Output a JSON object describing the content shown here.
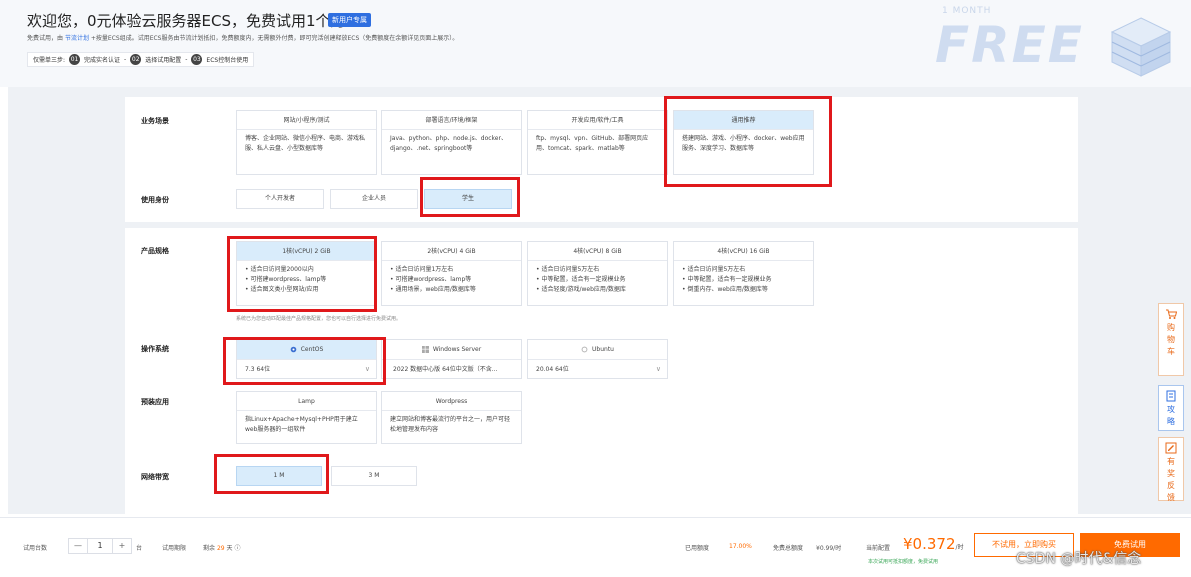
{
  "header": {
    "title": "欢迎您，0元体验云服务器ECS，免费试用1个月",
    "new_badge": "新用户专属",
    "desc_prefix": "免费试用，由",
    "desc_link": "节流计划",
    "desc_rest": "+按量ECS组成。试用ECS服务由节流计划抵扣，免费额度内，无需额外付费，即可完活创建释放ECS（免费额度在余额详见页面上展示）。",
    "steps_intro": "仅需单三步:",
    "steps": [
      {
        "num": "01",
        "label": "完成实名认证"
      },
      {
        "num": "02",
        "label": "选择试用配置"
      },
      {
        "num": "03",
        "label": "ECS控制台使用"
      }
    ],
    "banner_small": "1 MONTH",
    "banner_big": "FREE"
  },
  "scenario": {
    "label": "业务场景",
    "cards": [
      {
        "title": "网站/小程序/测试",
        "body": "博客、企业网站、微信小程序、电商、游戏私服、私人云盘、小型数据库等"
      },
      {
        "title": "部署语言/环境/框架",
        "body": "Java、python、php、node.js、docker、django、.net、springboot等"
      },
      {
        "title": "开发应用/软件/工具",
        "body": "ftp、mysql、vpn、GitHub、部署网页应用、tomcat、spark、matlab等"
      },
      {
        "title": "通用推荐",
        "body": "搭建网站、游戏、小程序、docker、web应用服务、深度学习、数据库等"
      }
    ]
  },
  "identity": {
    "label": "使用身份",
    "options": [
      "个人开发者",
      "企业人员",
      "学生"
    ]
  },
  "spec": {
    "label": "产品规格",
    "cards": [
      {
        "title": "1核(vCPU) 2 GiB",
        "items": [
          "适合日访问量2000以内",
          "可搭建wordpress、lamp等",
          "适合图文类小型网站/应用"
        ]
      },
      {
        "title": "2核(vCPU) 4 GiB",
        "items": [
          "适合日访问量1万左右",
          "可搭建wordpress、lamp等",
          "通用场景，web应用/数据库等"
        ]
      },
      {
        "title": "4核(vCPU) 8 GiB",
        "items": [
          "适合日访问量5万左右",
          "中等配置，适合有一定规模业务",
          "适合轻度/游戏/web应用/数据库"
        ]
      },
      {
        "title": "4核(vCPU) 16 GiB",
        "items": [
          "适合日访问量5万左右",
          "中等配置，适合有一定规模业务",
          "倒重内存、web应用/数据库等"
        ]
      }
    ],
    "note": "系统已为您自动匹配最佳产品规格配置，您也可以自行选择进行免费试用。"
  },
  "os": {
    "label": "操作系统",
    "options": [
      {
        "name": "CentOS",
        "version": "7.3 64位"
      },
      {
        "name": "Windows Server",
        "version": "2022 数据中心版 64位中文版（不含..."
      },
      {
        "name": "Ubuntu",
        "version": "20.04 64位"
      }
    ]
  },
  "preinstall": {
    "label": "预装应用",
    "cards": [
      {
        "title": "Lamp",
        "body": "指Linux+Apache+Mysql+PHP用于建立web服务器的一组软件"
      },
      {
        "title": "Wordpress",
        "body": "建立网站和博客最流行的平台之一，用户可轻松地管理发布内容"
      }
    ]
  },
  "bandwidth": {
    "label": "网络带宽",
    "options": [
      "1 M",
      "3 M"
    ]
  },
  "side_tabs": [
    {
      "label": "购物车",
      "icon": "cart-icon"
    },
    {
      "label": "攻略",
      "icon": "guide-icon"
    },
    {
      "label": "有奖反馈",
      "icon": "feedback-icon"
    }
  ],
  "bottom": {
    "qty_label": "试用台数",
    "qty_value": "1",
    "qty_unit": "台",
    "period_label": "试用期限",
    "period_prefix": "剩余",
    "period_days": "29",
    "period_unit": "天",
    "used_label": "已用额度",
    "used_value": "17.00%",
    "total_label": "免费总额度",
    "total_value": "¥0.99/时",
    "current_label": "当前配置",
    "current_price": "¥0.372",
    "current_unit": "/时",
    "note": "本次试用可抵扣额度，免费试用",
    "btn_buy": "不试用，立即购买",
    "btn_try": "免费试用"
  },
  "watermark": "CSDN @时代&信念",
  "colors": {
    "accent": "#2f6fe0",
    "orange": "#ff6a00",
    "selected_bg": "#d9ecfb",
    "highlight_red": "#e0181b"
  }
}
